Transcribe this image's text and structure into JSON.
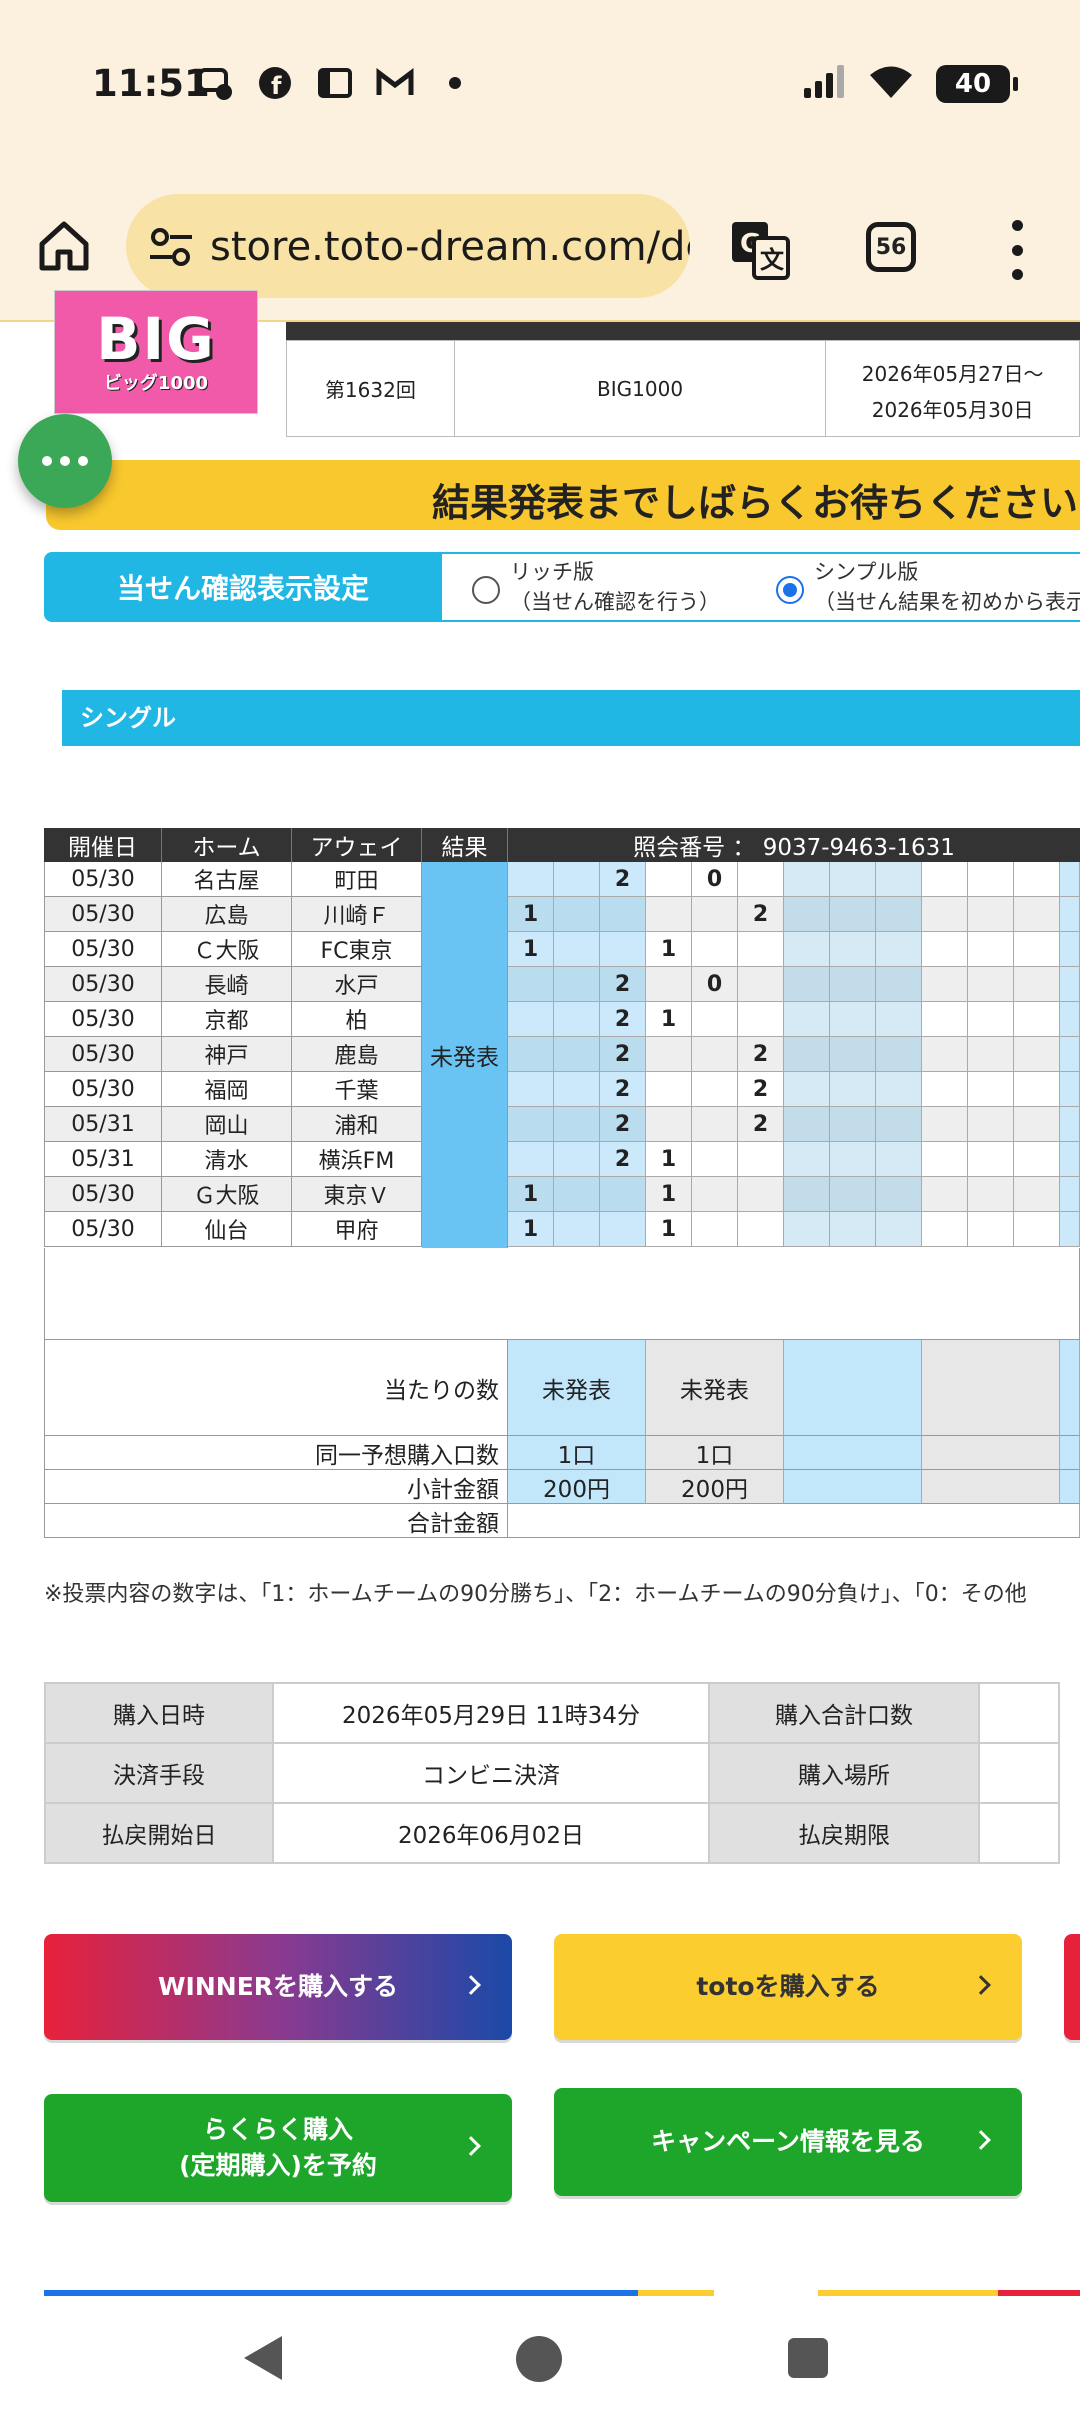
{
  "status": {
    "time": "11:51",
    "battery": "40"
  },
  "toolbar": {
    "url": "store.toto-dream.com/dc",
    "tab_count": "56"
  },
  "info": {
    "round": "第1632回",
    "product": "BIG1000",
    "period_line1": "2026年05月27日～",
    "period_line2": "2026年05月30日"
  },
  "logo": {
    "main": "BIG",
    "sub": "ビッグ1000"
  },
  "notice": "結果発表までしばらくお待ちください",
  "settings": {
    "label": "当せん確認表示設定",
    "rich_title": "リッチ版",
    "rich_desc": "（当せん確認を行う）",
    "simple_title": "シンプル版",
    "simple_desc": "（当せん結果を初めから表示"
  },
  "section": "シングル",
  "grid": {
    "headers": {
      "date": "開催日",
      "home": "ホーム",
      "away": "アウェイ",
      "result": "結果",
      "ref": "照会番号 ： 9037-9463-1631"
    },
    "result_status": "未発表",
    "matches": [
      {
        "date": "05/30",
        "home": "名古屋",
        "away": "町田",
        "picks": [
          "",
          "",
          "2",
          "",
          "0",
          ""
        ]
      },
      {
        "date": "05/30",
        "home": "広島",
        "away": "川崎Ｆ",
        "picks": [
          "1",
          "",
          "",
          "",
          "",
          "2"
        ]
      },
      {
        "date": "05/30",
        "home": "Ｃ大阪",
        "away": "FC東京",
        "picks": [
          "1",
          "",
          "",
          "1",
          "",
          ""
        ]
      },
      {
        "date": "05/30",
        "home": "長崎",
        "away": "水戸",
        "picks": [
          "",
          "",
          "2",
          "",
          "0",
          ""
        ]
      },
      {
        "date": "05/30",
        "home": "京都",
        "away": "柏",
        "picks": [
          "",
          "",
          "2",
          "1",
          "",
          ""
        ]
      },
      {
        "date": "05/30",
        "home": "神戸",
        "away": "鹿島",
        "picks": [
          "",
          "",
          "2",
          "",
          "",
          "2"
        ]
      },
      {
        "date": "05/30",
        "home": "福岡",
        "away": "千葉",
        "picks": [
          "",
          "",
          "2",
          "",
          "",
          "2"
        ]
      },
      {
        "date": "05/31",
        "home": "岡山",
        "away": "浦和",
        "picks": [
          "",
          "",
          "2",
          "",
          "",
          "2"
        ]
      },
      {
        "date": "05/31",
        "home": "清水",
        "away": "横浜FM",
        "picks": [
          "",
          "",
          "2",
          "1",
          "",
          ""
        ]
      },
      {
        "date": "05/30",
        "home": "Ｇ大阪",
        "away": "東京Ｖ",
        "picks": [
          "1",
          "",
          "",
          "1",
          "",
          ""
        ]
      },
      {
        "date": "05/30",
        "home": "仙台",
        "away": "甲府",
        "picks": [
          "1",
          "",
          "",
          "1",
          "",
          ""
        ]
      }
    ]
  },
  "summary": {
    "wins_label": "当たりの数",
    "wins_1": "未発表",
    "wins_2": "未発表",
    "units_label": "同一予想購入口数",
    "units_1": "1口",
    "units_2": "1口",
    "subtotal_label": "小計金額",
    "subtotal_1": "200円",
    "subtotal_2": "200円",
    "total_label": "合計金額"
  },
  "note": "※投票内容の数字は、「1：ホームチームの90分勝ち」、「2：ホームチームの90分負け」、「0：その他",
  "purchase": {
    "date_label": "購入日時",
    "date_value": "2026年05月29日 11時34分",
    "units_label": "購入合計口数",
    "method_label": "決済手段",
    "method_value": "コンビニ決済",
    "place_label": "購入場所",
    "refund_start_label": "払戻開始日",
    "refund_start_value": "2026年06月02日",
    "refund_end_label": "払戻期限"
  },
  "buttons": {
    "winner": "WINNERを購入する",
    "toto": "totoを購入する",
    "rakuraku_line1": "らくらく購入",
    "rakuraku_line2": "(定期購入)を予約",
    "campaign": "キャンペーン情報を見る"
  },
  "colors": {
    "accent_blue": "#21b7e5",
    "banner_yellow": "#f9c82e",
    "green": "#1ea62b",
    "result_blue": "#6ac4f3"
  }
}
